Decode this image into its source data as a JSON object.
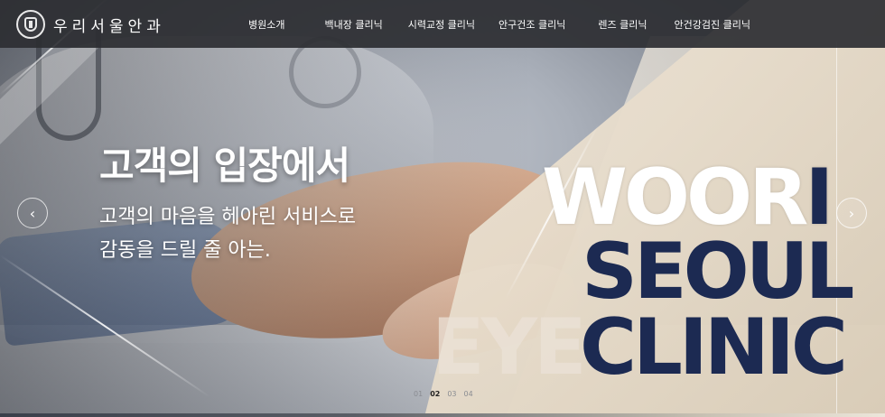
{
  "header": {
    "brand_name": "우리서울안과",
    "nav": [
      "병원소개",
      "백내장 클리닉",
      "시력교정 클리닉",
      "안구건조 클리닉",
      "렌즈 클리닉",
      "안건강검진 클리닉"
    ]
  },
  "hero": {
    "headline": "고객의 입장에서",
    "subline_1": "고객의 마음을 헤아린 서비스로",
    "subline_2": "감동을 드릴 줄 아는.",
    "brand_line_1_light": "W",
    "brand_line_1_rest_light": "OOR",
    "brand_line_1_dark": "I",
    "brand_line_2": "SEOUL",
    "brand_line_3a": "EYE",
    "brand_line_3b": "CLINIC",
    "prev_icon": "chevron-left-icon",
    "next_icon": "chevron-right-icon",
    "prev_glyph": "‹",
    "next_glyph": "›"
  },
  "pager": {
    "pages": [
      "01",
      "02",
      "03",
      "04"
    ],
    "active": "02"
  },
  "colors": {
    "header_bg": "#2d2e32",
    "brand_navy": "#1c2a52",
    "cream": "#efe6d8"
  }
}
